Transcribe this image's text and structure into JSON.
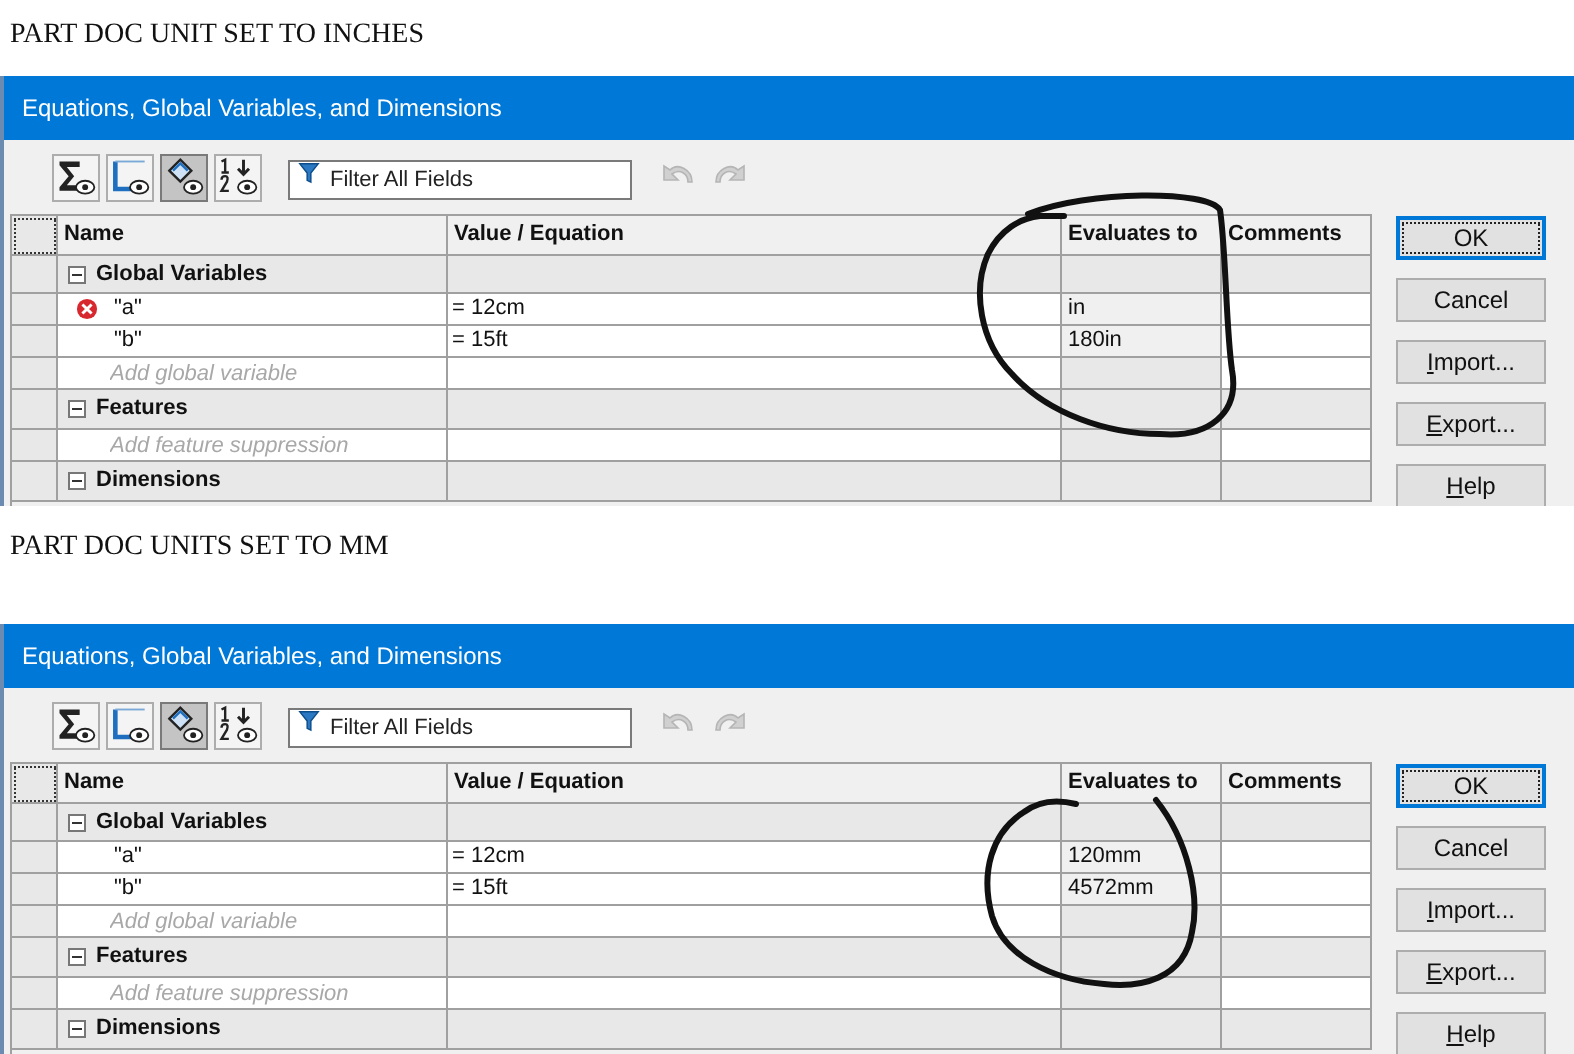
{
  "panels": [
    {
      "caption": "PART DOC UNIT SET TO INCHES",
      "dialog": {
        "title": "Equations, Global Variables, and Dimensions",
        "toolbar": [
          {
            "kind": "sigma",
            "selected": false
          },
          {
            "kind": "frame",
            "selected": false
          },
          {
            "kind": "dimension",
            "selected": true
          },
          {
            "kind": "order",
            "selected": false
          }
        ],
        "filter": {
          "placeholder": "Filter All Fields"
        },
        "undo": {
          "disabled": true
        },
        "redo": {
          "disabled": true
        },
        "columns": [
          "Name",
          "Value / Equation",
          "Evaluates to",
          "Comments"
        ],
        "rows": [
          {
            "kind": "group",
            "name": "Global Variables",
            "expanded": true
          },
          {
            "kind": "variable",
            "name": "\"a\"",
            "value": "= 12cm",
            "evaluates": "in",
            "error": true
          },
          {
            "kind": "variable",
            "name": "\"b\"",
            "value": "= 15ft",
            "evaluates": "180in",
            "error": false
          },
          {
            "kind": "add",
            "placeholder": "Add global variable"
          },
          {
            "kind": "group",
            "name": "Features",
            "expanded": true
          },
          {
            "kind": "add",
            "placeholder": "Add feature suppression"
          },
          {
            "kind": "group",
            "name": "Dimensions",
            "expanded": true
          }
        ],
        "buttons": [
          {
            "label": "OK",
            "default": true,
            "underline_first": false
          },
          {
            "label": "Cancel",
            "default": false,
            "underline_first": false
          },
          {
            "label": "Import...",
            "default": false,
            "underline_first": true
          },
          {
            "label": "Export...",
            "default": false,
            "underline_first": true
          },
          {
            "label": "Help",
            "default": false,
            "underline_first": true
          }
        ]
      }
    },
    {
      "caption": "PART DOC UNITS SET TO MM",
      "dialog": {
        "title": "Equations, Global Variables, and Dimensions",
        "toolbar": [
          {
            "kind": "sigma",
            "selected": false
          },
          {
            "kind": "frame",
            "selected": false
          },
          {
            "kind": "dimension",
            "selected": true
          },
          {
            "kind": "order",
            "selected": false
          }
        ],
        "filter": {
          "placeholder": "Filter All Fields"
        },
        "undo": {
          "disabled": true
        },
        "redo": {
          "disabled": true
        },
        "columns": [
          "Name",
          "Value / Equation",
          "Evaluates to",
          "Comments"
        ],
        "rows": [
          {
            "kind": "group",
            "name": "Global Variables",
            "expanded": true
          },
          {
            "kind": "variable",
            "name": "\"a\"",
            "value": "= 12cm",
            "evaluates": "120mm",
            "error": false
          },
          {
            "kind": "variable",
            "name": "\"b\"",
            "value": "= 15ft",
            "evaluates": "4572mm",
            "error": false
          },
          {
            "kind": "add",
            "placeholder": "Add global variable"
          },
          {
            "kind": "group",
            "name": "Features",
            "expanded": true
          },
          {
            "kind": "add",
            "placeholder": "Add feature suppression"
          },
          {
            "kind": "group",
            "name": "Dimensions",
            "expanded": true
          }
        ],
        "buttons": [
          {
            "label": "OK",
            "default": true,
            "underline_first": false
          },
          {
            "label": "Cancel",
            "default": false,
            "underline_first": false
          },
          {
            "label": "Import...",
            "default": false,
            "underline_first": true
          },
          {
            "label": "Export...",
            "default": false,
            "underline_first": true
          },
          {
            "label": "Help",
            "default": false,
            "underline_first": true
          }
        ]
      }
    }
  ]
}
